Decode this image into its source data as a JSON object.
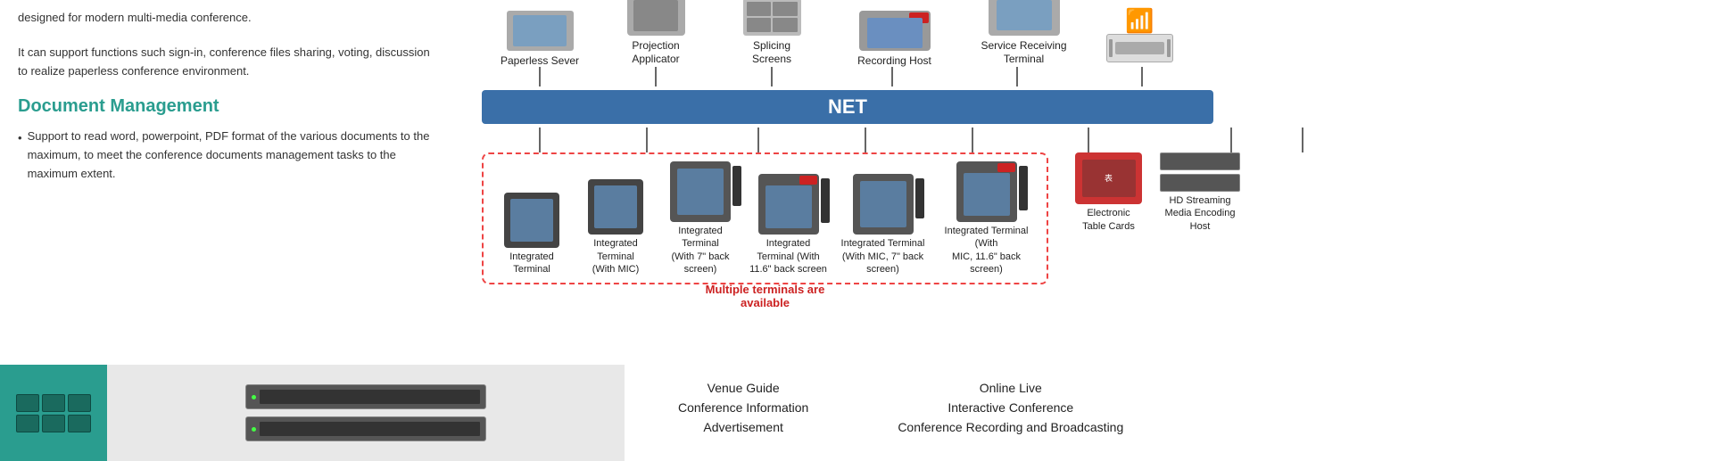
{
  "left": {
    "intro_text": "designed for modern multi-media conference.",
    "intro_text2": "It can support functions such sign-in, conference files sharing, voting, discussion to realize paperless conference environment.",
    "doc_management_title": "Document Management",
    "bullet_items": [
      "Support to read word, powerpoint, PDF format of the various documents to the maximum, to meet the conference documents management tasks to the maximum extent."
    ]
  },
  "diagram": {
    "net_label": "NET",
    "top_devices": [
      {
        "label": "Paperless Sever",
        "type": "server"
      },
      {
        "label": "Projection\nApplicator",
        "type": "projector"
      },
      {
        "label": "Splicing\nScreens",
        "type": "splicing"
      },
      {
        "label": "Recording Host",
        "type": "recording"
      },
      {
        "label": "Service Receiving\nTerminal",
        "type": "terminal"
      }
    ],
    "terminals": [
      {
        "label": "Integrated\nTerminal",
        "has_back": false,
        "has_red": false
      },
      {
        "label": "Integrated\nTerminal\n(With MIC)",
        "has_back": false,
        "has_red": false
      },
      {
        "label": "Integrated\nTerminal\n(With 7\" back\nscreen)",
        "has_back": true,
        "has_red": false
      },
      {
        "label": "Integrated\nTerminal (With\n11.6\" back screen",
        "has_back": true,
        "has_red": true
      },
      {
        "label": "Integrated Terminal\n(With MIC, 7\" back\nscreen)",
        "has_back": true,
        "has_red": false
      },
      {
        "label": "Integrated Terminal (With\nMIC, 11.6\" back screen)",
        "has_back": true,
        "has_red": true
      }
    ],
    "multiple_terminals_text": "Multiple terminals are\navailable",
    "right_devices": [
      {
        "label": "Electronic\nTable Cards"
      },
      {
        "label": "HD Streaming\nMedia Encoding\nHost"
      }
    ]
  },
  "bottom": {
    "left_col": [
      "Venue Guide",
      "Conference Information",
      "Advertisement"
    ],
    "right_col": [
      "Online Live",
      "Interactive Conference",
      "Conference Recording and Broadcasting"
    ]
  }
}
